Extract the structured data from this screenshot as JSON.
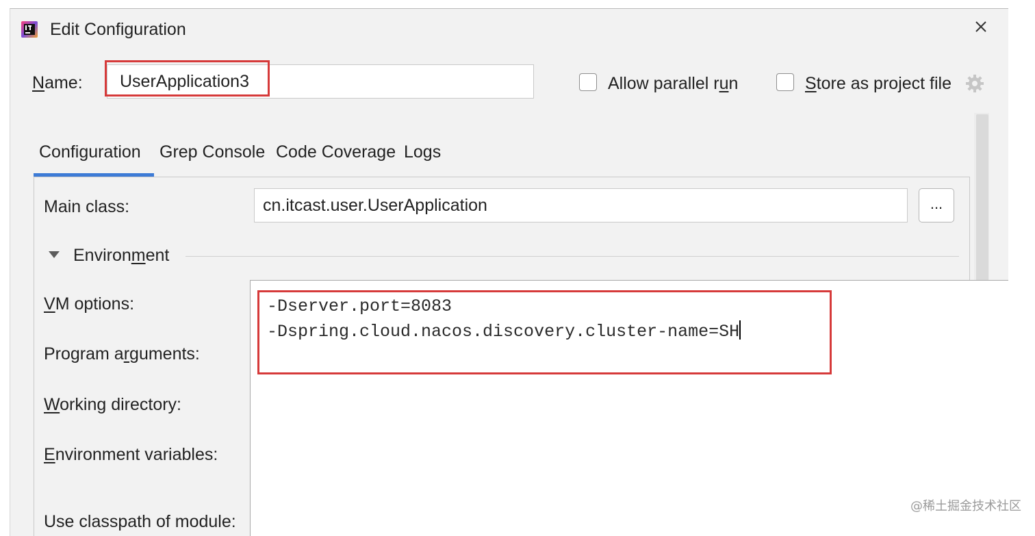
{
  "window": {
    "title": "Edit Configuration",
    "close_icon": "close-icon",
    "app_icon": "intellij-icon"
  },
  "name_field": {
    "label_mnemonic": "N",
    "label_rest": "ame:",
    "value": "UserApplication3"
  },
  "options": {
    "allow_parallel": {
      "text_before": "Allow parallel r",
      "mnemonic": "u",
      "text_after": "n",
      "checked": false
    },
    "store_project": {
      "text_before": "",
      "mnemonic": "S",
      "text_after": "tore as project file",
      "checked": false
    },
    "settings_icon": "gear-icon"
  },
  "tabs": [
    {
      "label": "Configuration",
      "active": true
    },
    {
      "label": "Grep Console",
      "active": false
    },
    {
      "label": "Code Coverage",
      "active": false
    },
    {
      "label": "Logs",
      "active": false
    }
  ],
  "main_class": {
    "label": "Main class:",
    "value": "cn.itcast.user.UserApplication",
    "browse_label": "..."
  },
  "environment": {
    "text_before": "Environ",
    "mnemonic": "m",
    "text_after": "ent",
    "expanded": true
  },
  "labels": {
    "vm_options": {
      "mnemonic": "V",
      "rest": "M options:"
    },
    "program_arguments": {
      "before": "Program a",
      "mnemonic": "r",
      "after": "guments:"
    },
    "working_directory": {
      "mnemonic": "W",
      "rest": "orking directory:"
    },
    "environment_variables": {
      "mnemonic": "E",
      "rest": "nvironment variables:"
    },
    "use_classpath": "Use classpath of module:"
  },
  "vm_options": {
    "lines": [
      "-Dserver.port=8083",
      "-Dspring.cloud.nacos.discovery.cluster-name=SH"
    ]
  },
  "colors": {
    "highlight": "#d63a3a",
    "tab_accent": "#3d7bd6",
    "dialog_bg": "#f2f2f2"
  },
  "watermark": "@稀土掘金技术社区"
}
